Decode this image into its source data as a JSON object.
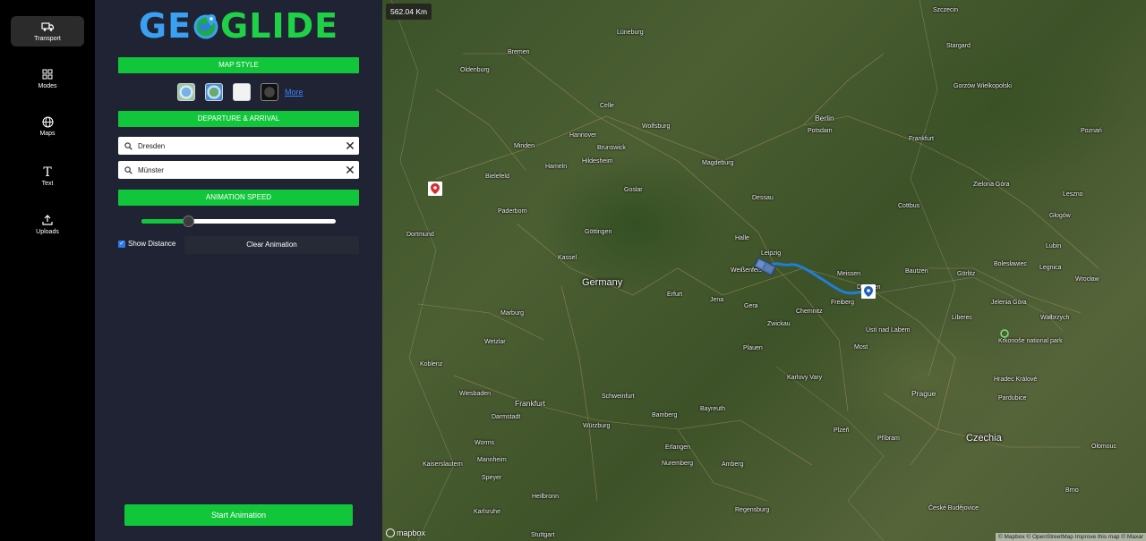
{
  "sidebar": {
    "items": [
      {
        "label": "Transport",
        "icon": "truck-icon"
      },
      {
        "label": "Modes",
        "icon": "grid-icon"
      },
      {
        "label": "Maps",
        "icon": "globe-icon"
      },
      {
        "label": "Text",
        "icon": "text-icon"
      },
      {
        "label": "Uploads",
        "icon": "upload-icon"
      }
    ]
  },
  "panel": {
    "logo_left": "GE",
    "logo_right": "GLIDE",
    "map_style_label": "MAP STYLE",
    "more_link": "More",
    "departure_arrival_label": "DEPARTURE & ARRIVAL",
    "departure_value": "Dresden",
    "arrival_value": "Münster",
    "animation_speed_label": "ANIMATION SPEED",
    "speed_fraction": 0.24,
    "show_distance_label": "Show Distance",
    "show_distance_checked": true,
    "clear_animation_label": "Clear Animation",
    "start_animation_label": "Start Animation"
  },
  "map": {
    "distance_badge": "562.04 Km",
    "mapbox_label": "mapbox",
    "attribution": "© Mapbox © OpenStreetMap Improve this map © Maxar",
    "country_germany": "Germany",
    "country_czechia": "Czechia",
    "cities": {
      "berlin": "Berlin",
      "potsdam": "Potsdam",
      "hannover": "Hannover",
      "bremen": "Bremen",
      "oldenburg": "Oldenburg",
      "luneburg": "Lüneburg",
      "celle": "Celle",
      "wolfsburg": "Wolfsburg",
      "braunschweig": "Brunswick",
      "magdeburg": "Magdeburg",
      "hildesheim": "Hildesheim",
      "minden": "Minden",
      "hameln": "Hameln",
      "bielefeld": "Bielefeld",
      "paderborn": "Paderborn",
      "dortmund": "Dortmund",
      "goslar": "Goslar",
      "gottingen": "Göttingen",
      "kassel": "Kassel",
      "dessau": "Dessau",
      "halle": "Halle",
      "leipzig": "Leipzig",
      "weissenfels": "Weißenfels",
      "meissen": "Meissen",
      "dresden": "Dresden",
      "freiberg": "Freiberg",
      "chemnitz": "Chemnitz",
      "zwickau": "Zwickau",
      "gera": "Gera",
      "jena": "Jena",
      "erfurt": "Erfurt",
      "marburg": "Marburg",
      "wetzlar": "Wetzlar",
      "koblenz": "Koblenz",
      "wiesbaden": "Wiesbaden",
      "frankfurt": "Frankfurt",
      "darmstadt": "Darmstadt",
      "schweinfurt": "Schweinfurt",
      "bamberg": "Bamberg",
      "bayreuth": "Bayreuth",
      "wurzburg": "Würzburg",
      "worms": "Worms",
      "mannheim": "Mannheim",
      "speyer": "Speyer",
      "kaiserslautern": "Kaiserslautern",
      "nuremberg": "Nuremberg",
      "erlangen": "Erlangen",
      "amberg": "Amberg",
      "heilbronn": "Heilbronn",
      "karlsruhe": "Karlsruhe",
      "regensburg": "Regensburg",
      "stuttgart": "Stuttgart",
      "plauen": "Plauen",
      "prague": "Prague",
      "plzen": "Plzeň",
      "pribram": "Příbram",
      "karlovy_vary": "Karlovy Vary",
      "usti": "Ústí nad Labem",
      "most": "Most",
      "liberec": "Liberec",
      "jelenia_gora": "Jelenia Góra",
      "walbrzych": "Wałbrzych",
      "legnica": "Legnica",
      "wroclaw": "Wrocław",
      "glogow": "Głogów",
      "lubin": "Lubin",
      "zielona_gora": "Zielona Góra",
      "cottbus": "Cottbus",
      "bautzen": "Bautzen",
      "gorlitz": "Görlitz",
      "boleslawiec": "Bolesławiec",
      "frankfurt_oder": "Frankfurt",
      "gorzow": "Gorzów Wielkopolski",
      "szczecin": "Szczecin",
      "stargard": "Stargard",
      "poznan": "Poznań",
      "leszno": "Leszno",
      "hradec": "Hradec Králové",
      "pardubice": "Pardubice",
      "brno": "Brno",
      "olomouc": "Olomouc",
      "ceske_budejovice": "České Budějovice",
      "krkonose": "Krkonoše national park"
    }
  }
}
